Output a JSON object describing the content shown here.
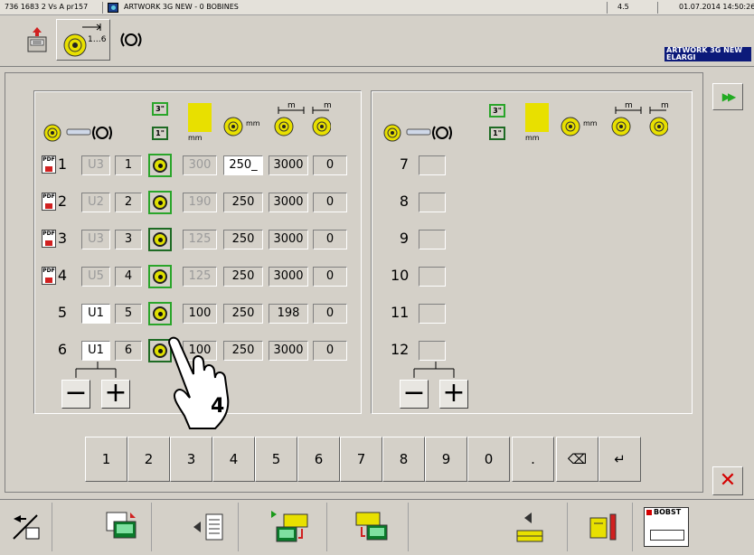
{
  "titlebar": {
    "machine": "736 1683 2 Vs A pr157",
    "job": "ARTWORK 3G NEW - 0 BOBINES",
    "version": "4.5",
    "datetime": "01.07.2014 14:50:26"
  },
  "job_label": "ARTWORK 3G NEW\nELARGI",
  "left_headers": {
    "in3": "3\"",
    "in1": "1\"",
    "mm": "mm",
    "mm2": "mm",
    "m1": "m",
    "m2": "m"
  },
  "left_rows": [
    {
      "num": "1",
      "pdf": "PDF",
      "u": "U3",
      "idx": "1",
      "a": "300",
      "b": "250_",
      "c": "3000",
      "d": "0",
      "spool_dark": false
    },
    {
      "num": "2",
      "pdf": "PDF",
      "u": "U2",
      "idx": "2",
      "a": "190",
      "b": "250",
      "c": "3000",
      "d": "0",
      "spool_dark": false
    },
    {
      "num": "3",
      "pdf": "PDF",
      "u": "U3",
      "idx": "3",
      "a": "125",
      "b": "250",
      "c": "3000",
      "d": "0",
      "spool_dark": true
    },
    {
      "num": "4",
      "pdf": "PDF",
      "u": "U5",
      "idx": "4",
      "a": "125",
      "b": "250",
      "c": "3000",
      "d": "0",
      "spool_dark": false
    },
    {
      "num": "5",
      "pdf": "",
      "u": "U1",
      "idx": "5",
      "a": "100",
      "b": "250",
      "c": "198",
      "d": "0",
      "spool_dark": false
    },
    {
      "num": "6",
      "pdf": "",
      "u": "U1",
      "idx": "6",
      "a": "100",
      "b": "250",
      "c": "3000",
      "d": "0",
      "spool_dark": true
    }
  ],
  "right_rows": [
    "7",
    "8",
    "9",
    "10",
    "11",
    "12"
  ],
  "minus_label": "−",
  "plus_label": "+",
  "callout": "4",
  "keypad": [
    "1",
    "2",
    "3",
    "4",
    "5",
    "6",
    "7",
    "8",
    "9",
    "0",
    ".",
    "⌫",
    "↵"
  ],
  "forward_label": "▶▶",
  "close_label": "✕",
  "bottom_brand": "BOBST",
  "colors": {
    "spool_green": "#2aa52a",
    "spool_dark": "#1e6b24",
    "label_blue": "#0c1a7a",
    "close_red": "#d40000",
    "yellow": "#e8e000"
  }
}
